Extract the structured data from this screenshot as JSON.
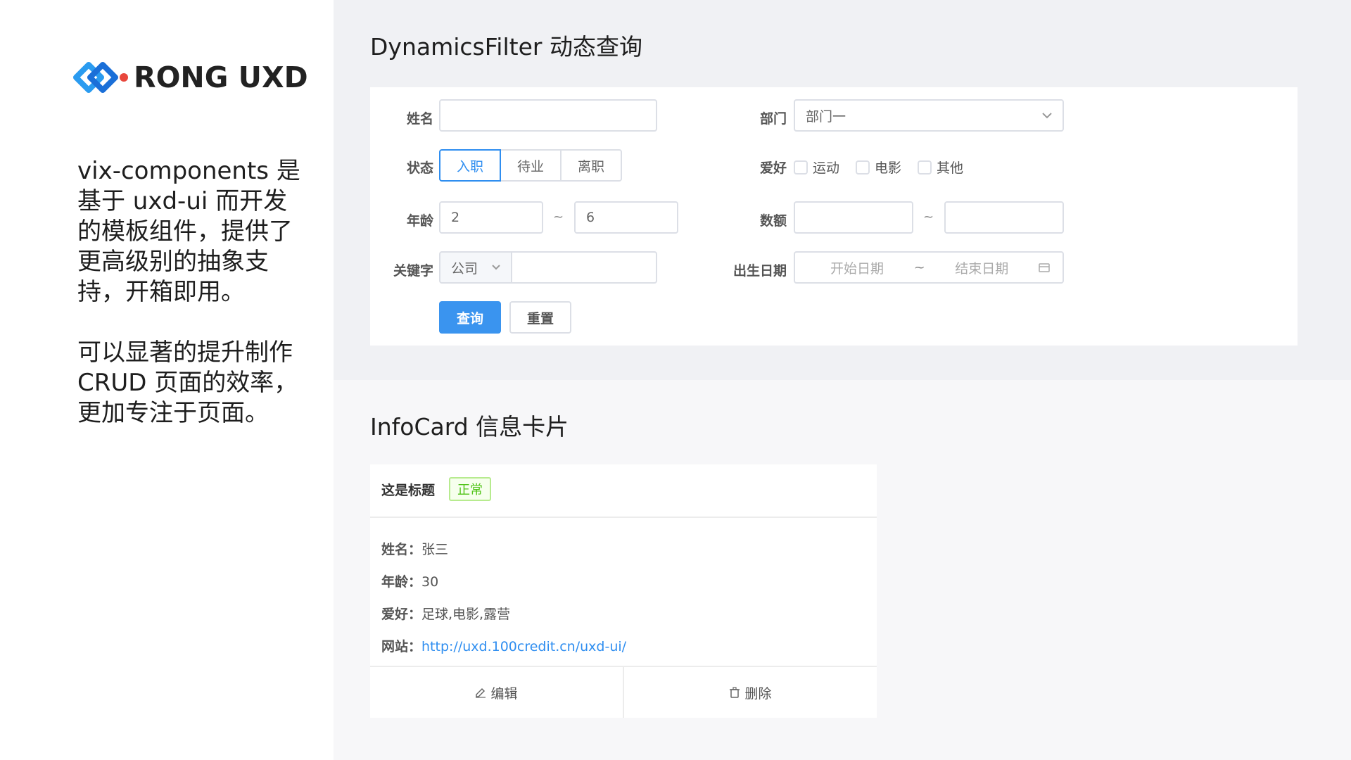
{
  "brand": {
    "name": "RONG UXD",
    "primary": "#2f8ef0",
    "accent": "#e8473c"
  },
  "intro": {
    "p1": "vix-components 是基于 uxd-ui 而开发的模板组件，提供了更高级别的抽象支持，开箱即用。",
    "p2": "可以显著的提升制作 CRUD 页面的效率，更加专注于页面。"
  },
  "filter": {
    "title": "DynamicsFilter 动态查询",
    "name_label": "姓名",
    "name_value": "",
    "dept_label": "部门",
    "dept_value": "部门一",
    "status_label": "状态",
    "status_options": [
      "入职",
      "待业",
      "离职"
    ],
    "status_selected": "入职",
    "hobby_label": "爱好",
    "hobby_options": [
      "运动",
      "电影",
      "其他"
    ],
    "age_label": "年龄",
    "age_from": "2",
    "age_to": "6",
    "amount_label": "数额",
    "amount_from": "",
    "amount_to": "",
    "keyword_label": "关键字",
    "keyword_type": "公司",
    "keyword_value": "",
    "birth_label": "出生日期",
    "birth_start_placeholder": "开始日期",
    "birth_end_placeholder": "结束日期",
    "range_sep": "~",
    "search_btn": "查询",
    "reset_btn": "重置"
  },
  "infocard": {
    "title": "InfoCard 信息卡片",
    "card_title": "这是标题",
    "badge": "正常",
    "rows": [
      {
        "k": "姓名：",
        "v": "张三"
      },
      {
        "k": "年龄：",
        "v": "30"
      },
      {
        "k": "爱好：",
        "v": "足球,电影,露营"
      },
      {
        "k": "网站：",
        "v": "http://uxd.100credit.cn/uxd-ui/"
      }
    ],
    "edit_btn": "编辑",
    "delete_btn": "删除"
  }
}
